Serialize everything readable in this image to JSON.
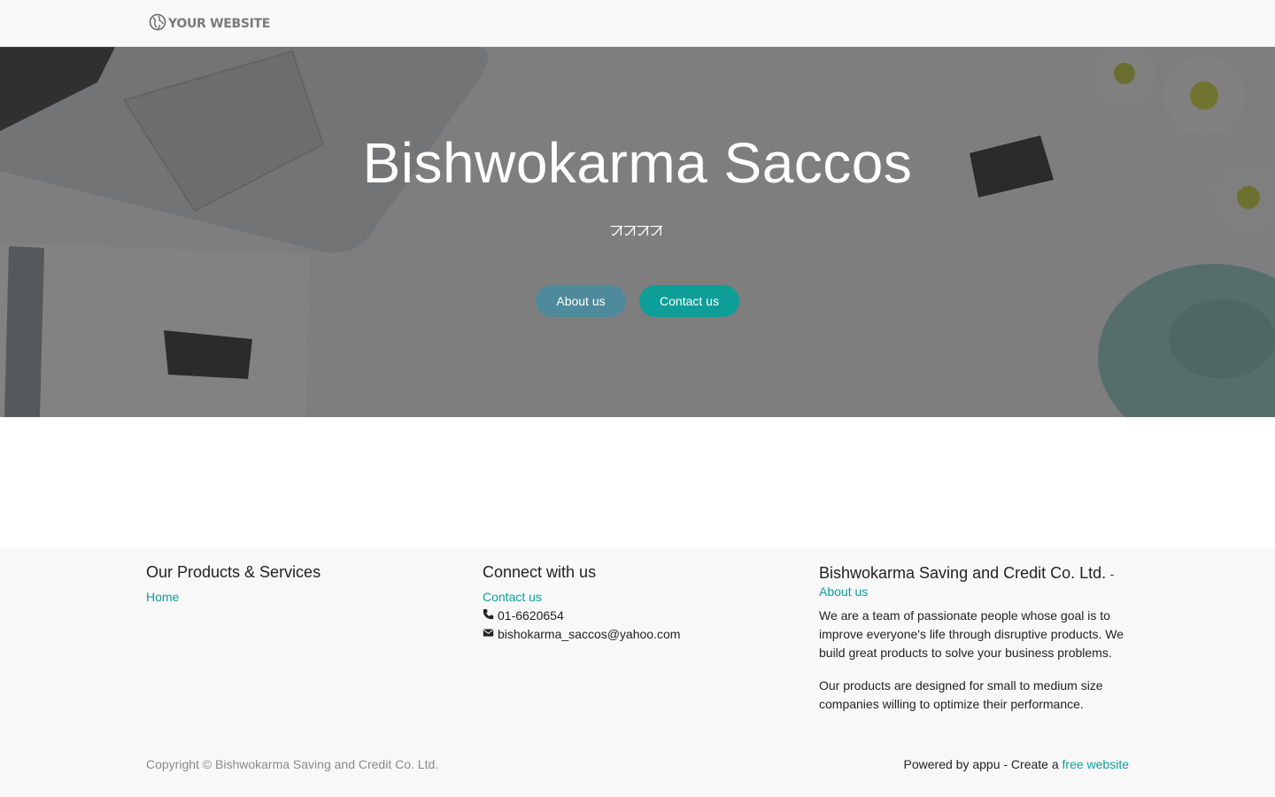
{
  "navbar": {
    "brand": "YOUR WEBSITE",
    "brand_icon": "globe-icon"
  },
  "hero": {
    "title": "Bishwokarma Saccos",
    "subtitle": "ꠀꠀꠀꠀ",
    "about_button": "About us",
    "contact_button": "Contact us",
    "colors": {
      "about": "#4e8a9c",
      "contact": "#0e9e98"
    }
  },
  "footer": {
    "products": {
      "heading": "Our Products & Services",
      "home_link": "Home"
    },
    "connect": {
      "heading": "Connect with us",
      "contact_link": "Contact us",
      "phone": "01-6620654",
      "email": "bishokarma_saccos@yahoo.com"
    },
    "company": {
      "name": "Bishwokarma Saving and Credit Co. Ltd.",
      "separator": "-",
      "about_link": "About us",
      "para1": "We are a team of passionate people whose goal is to improve everyone's life through disruptive products. We build great products to solve your business problems.",
      "para2": "Our products are designed for small to medium size companies willing to optimize their performance."
    },
    "copyright": "Copyright © Bishwokarma Saving and Credit Co. Ltd.",
    "powered_prefix": "Powered by appu - Create a",
    "powered_link": "free website"
  },
  "accent_color": "#0e9e98"
}
